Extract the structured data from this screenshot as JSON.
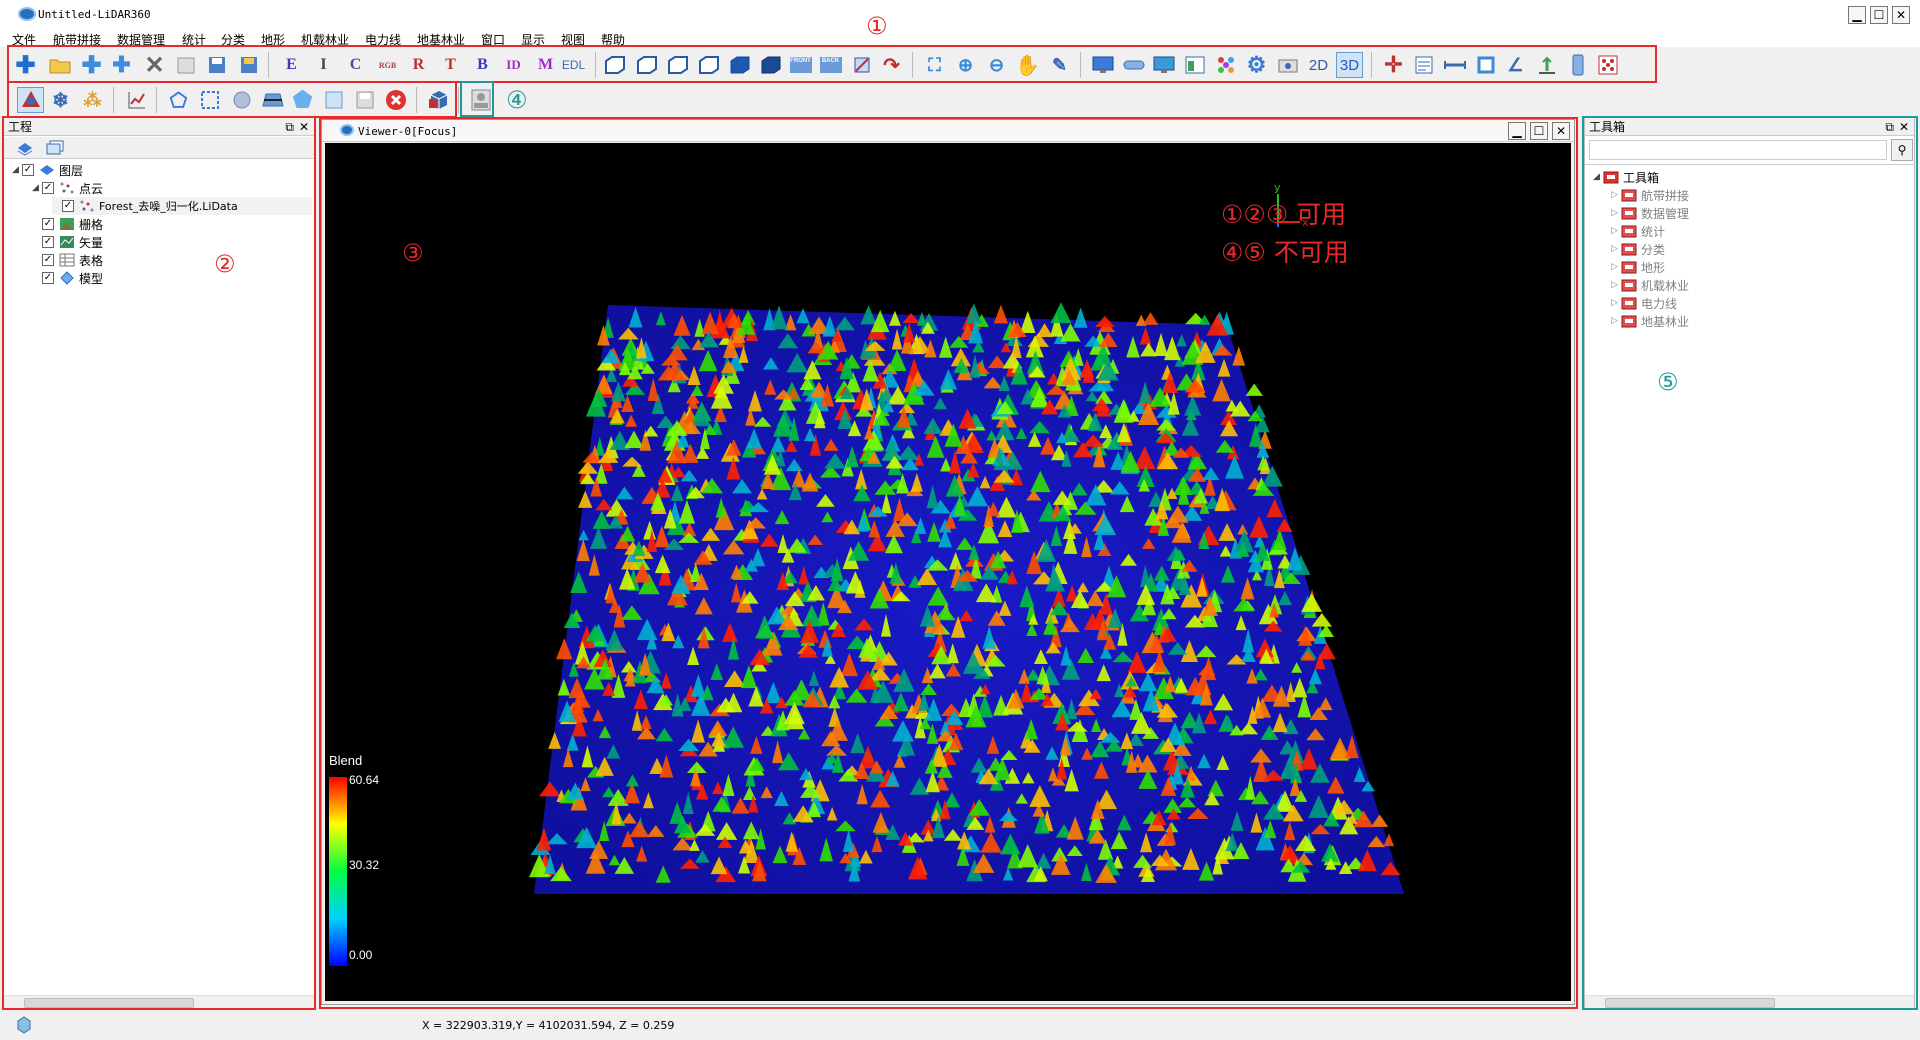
{
  "window": {
    "title": "Untitled-LiDAR360",
    "buttons": {
      "minimize": "▁",
      "maximize": "☐",
      "close": "✕"
    }
  },
  "menu": [
    "文件",
    "航带拼接",
    "数据管理",
    "统计",
    "分类",
    "地形",
    "机载林业",
    "电力线",
    "地基林业",
    "窗口",
    "显示",
    "视图",
    "帮助"
  ],
  "toolbar": {
    "letter_buttons": [
      "E",
      "I",
      "C",
      "RGB",
      "R",
      "T",
      "B",
      "ID",
      "M",
      "EDL"
    ],
    "view_2d": "2D",
    "view_3d": "3D",
    "cube_front": "FRONT",
    "cube_back": "BACK"
  },
  "project_panel": {
    "title": "工程",
    "tree": {
      "layers": "图层",
      "pointcloud": "点云",
      "file": "Forest_去噪_归一化.LiData",
      "raster": "栅格",
      "vector": "矢量",
      "table": "表格",
      "model": "模型"
    }
  },
  "viewer": {
    "title": "Viewer-0[Focus]",
    "legend": {
      "label": "Blend",
      "max": "60.64",
      "mid": "30.32",
      "min": "0.00"
    },
    "axis": {
      "x": "x",
      "y": "y"
    }
  },
  "toolbox_panel": {
    "title": "工具箱",
    "search_placeholder": "",
    "root": "工具箱",
    "items": [
      "航带拼接",
      "数据管理",
      "统计",
      "分类",
      "地形",
      "机载林业",
      "电力线",
      "地基林业"
    ]
  },
  "annotations": {
    "n1": "①",
    "n2": "②",
    "n3": "③",
    "n4": "④",
    "n5": "⑤",
    "available": "①②③ 可用",
    "unavailable": "④⑤ 不可用"
  },
  "status": {
    "coords": "X = 322903.319,Y = 4102031.594, Z = 0.259"
  },
  "colors": {
    "annot_red": "#e8282b",
    "annot_teal": "#1e9a9a",
    "ground_blue": "#1a1ad0"
  }
}
